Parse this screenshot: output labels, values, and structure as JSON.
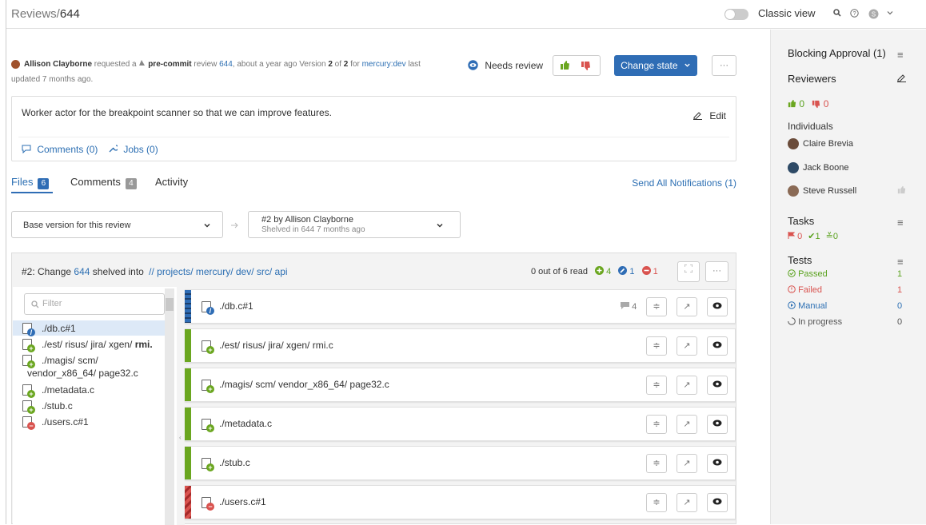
{
  "breadcrumb": {
    "section": "Reviews/",
    "id": "644"
  },
  "header": {
    "classic_view": "Classic view"
  },
  "request": {
    "author": "Allison Clayborne",
    "t1": "requested a",
    "tool": "pre-commit",
    "t2": "review",
    "review": "644",
    "t3": ", about a year ago Version",
    "v": "2",
    "t4": "of",
    "vt": "2",
    "t5": "for",
    "branch": "mercury:dev",
    "t6": "last",
    "updated": "updated 7 months ago."
  },
  "status": {
    "needs_review": "Needs review",
    "change_state": "Change state",
    "more": "···"
  },
  "description": {
    "text": "Worker actor for the breakpoint scanner so that we can improve features.",
    "edit": "Edit",
    "comments": "Comments (0)",
    "jobs": "Jobs (0)"
  },
  "tabs": {
    "files": "Files",
    "files_count": "6",
    "comments": "Comments",
    "comments_count": "4",
    "activity": "Activity",
    "notify": "Send All Notifications (1)"
  },
  "versions": {
    "base": "Base version for this review",
    "target": "#2 by Allison Clayborne",
    "target_sub": "Shelved in 644 7 months ago"
  },
  "change": {
    "prefix": "#2: Change",
    "number": "644",
    "mid": "shelved into",
    "path": "// projects/ mercury/ dev/ src/ api",
    "read": "0 out of 6 read",
    "added": "4",
    "edited": "1",
    "deleted": "1"
  },
  "tree": {
    "filter": "Filter",
    "items": [
      {
        "pre": "./",
        "name": "db.c#1",
        "type": "edit"
      },
      {
        "pre": "./est/ risus/ jira/ xgen/",
        "name": "rmi.",
        "type": "add"
      },
      {
        "pre": "./magis/ scm/",
        "pre2": "vendor_x86_64/",
        "name": "page32.c",
        "type": "add"
      },
      {
        "pre": "./",
        "name": "metadata.c",
        "type": "add"
      },
      {
        "pre": "./",
        "name": "stub.c",
        "type": "add"
      },
      {
        "pre": "./",
        "name": "users.c#1",
        "type": "del"
      }
    ]
  },
  "files": [
    {
      "pre": "./",
      "name": "db.c#1",
      "type": "edit",
      "comments": "4"
    },
    {
      "pre": "./est/ risus/ jira/ xgen/",
      "name": "rmi.c",
      "type": "add"
    },
    {
      "pre": "./magis/ scm/ vendor_x86_64/",
      "name": "page32.c",
      "type": "add"
    },
    {
      "pre": "./",
      "name": "metadata.c",
      "type": "add"
    },
    {
      "pre": "./",
      "name": "stub.c",
      "type": "add"
    },
    {
      "pre": "./",
      "name": "users.c#1",
      "type": "del"
    }
  ],
  "sidebar": {
    "blocking": "Blocking Approval (1)",
    "reviewers": "Reviewers",
    "up": "0",
    "down": "0",
    "individuals": "Individuals",
    "people": [
      "Claire Brevia",
      "Jack Boone",
      "Steve Russell"
    ],
    "tasks": "Tasks",
    "t_open": "0",
    "t_done": "1",
    "t_verified": "0",
    "tests": "Tests",
    "test_rows": [
      {
        "label": "Passed",
        "count": "1"
      },
      {
        "label": "Failed",
        "count": "1"
      },
      {
        "label": "Manual",
        "count": "0"
      },
      {
        "label": "In progress",
        "count": "0"
      }
    ]
  },
  "colors": {
    "primary": "#2f6db5",
    "added": "#6aa61f",
    "edited": "#2f6db5",
    "deleted": "#d9534f"
  }
}
